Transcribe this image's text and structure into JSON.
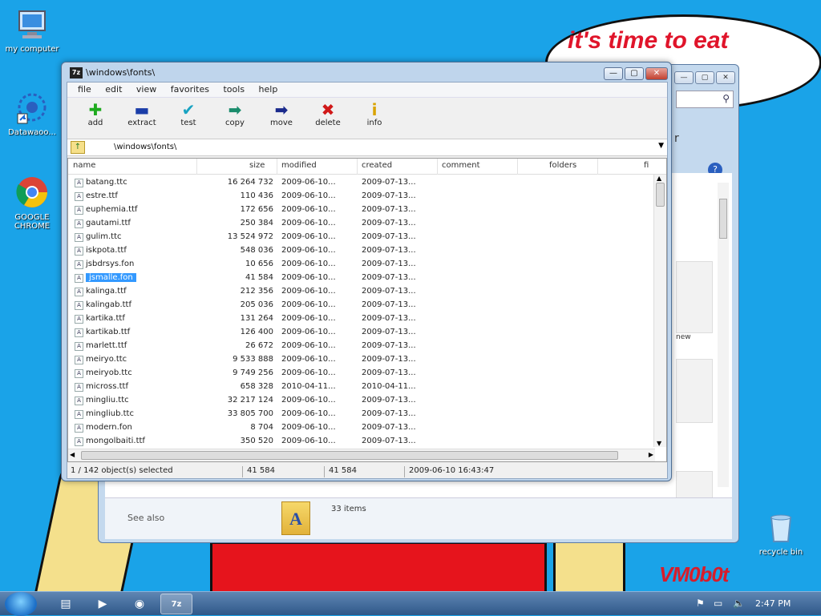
{
  "desktop": {
    "icons": [
      {
        "label": "my computer",
        "icon": "computer-icon"
      },
      {
        "label": "Datawaoo...",
        "icon": "datawaoo-icon"
      },
      {
        "label": "GOOGLE CHROME",
        "icon": "chrome-icon"
      },
      {
        "label": "recycle bin",
        "icon": "recycle-bin-icon"
      }
    ],
    "bubble_text": "it's time to eat",
    "watermark": "VM0b0t"
  },
  "background_window": {
    "see_also": "See also",
    "items_count": "33 items",
    "side_text_new": "new",
    "side_text_r": "r"
  },
  "zip_window": {
    "title": "\\windows\\fonts\\",
    "menu": [
      "file",
      "edit",
      "view",
      "favorites",
      "tools",
      "help"
    ],
    "toolbar": [
      {
        "label": "add",
        "icon": "add-icon",
        "glyph": "✚",
        "color": "#1faa1f"
      },
      {
        "label": "extract",
        "icon": "extract-icon",
        "glyph": "▬",
        "color": "#1a3da8"
      },
      {
        "label": "test",
        "icon": "test-icon",
        "glyph": "✔",
        "color": "#19a3c2"
      },
      {
        "label": "copy",
        "icon": "copy-icon",
        "glyph": "➡",
        "color": "#1a8c6c"
      },
      {
        "label": "move",
        "icon": "move-icon",
        "glyph": "➡",
        "color": "#1a2a8c"
      },
      {
        "label": "delete",
        "icon": "delete-icon",
        "glyph": "✖",
        "color": "#d01818"
      },
      {
        "label": "info",
        "icon": "info-icon",
        "glyph": "i",
        "color": "#d9a300"
      }
    ],
    "path": "\\windows\\fonts\\",
    "columns": [
      "name",
      "size",
      "modified",
      "created",
      "comment",
      "folders",
      "fi"
    ],
    "rows": [
      {
        "name": "batang.ttc",
        "size": "16 264 732",
        "modified": "2009-06-10...",
        "created": "2009-07-13..."
      },
      {
        "name": "estre.ttf",
        "size": "110 436",
        "modified": "2009-06-10...",
        "created": "2009-07-13..."
      },
      {
        "name": "euphemia.ttf",
        "size": "172 656",
        "modified": "2009-06-10...",
        "created": "2009-07-13..."
      },
      {
        "name": "gautami.ttf",
        "size": "250 384",
        "modified": "2009-06-10...",
        "created": "2009-07-13..."
      },
      {
        "name": "gulim.ttc",
        "size": "13 524 972",
        "modified": "2009-06-10...",
        "created": "2009-07-13..."
      },
      {
        "name": "iskpota.ttf",
        "size": "548 036",
        "modified": "2009-06-10...",
        "created": "2009-07-13..."
      },
      {
        "name": "jsbdrsys.fon",
        "size": "10 656",
        "modified": "2009-06-10...",
        "created": "2009-07-13..."
      },
      {
        "name": "jsmalle.fon",
        "size": "41 584",
        "modified": "2009-06-10...",
        "created": "2009-07-13...",
        "selected": true
      },
      {
        "name": "kalinga.ttf",
        "size": "212 356",
        "modified": "2009-06-10...",
        "created": "2009-07-13..."
      },
      {
        "name": "kalingab.ttf",
        "size": "205 036",
        "modified": "2009-06-10...",
        "created": "2009-07-13..."
      },
      {
        "name": "kartika.ttf",
        "size": "131 264",
        "modified": "2009-06-10...",
        "created": "2009-07-13..."
      },
      {
        "name": "kartikab.ttf",
        "size": "126 400",
        "modified": "2009-06-10...",
        "created": "2009-07-13..."
      },
      {
        "name": "marlett.ttf",
        "size": "26 672",
        "modified": "2009-06-10...",
        "created": "2009-07-13..."
      },
      {
        "name": "meiryo.ttc",
        "size": "9 533 888",
        "modified": "2009-06-10...",
        "created": "2009-07-13..."
      },
      {
        "name": "meiryob.ttc",
        "size": "9 749 256",
        "modified": "2009-06-10...",
        "created": "2009-07-13..."
      },
      {
        "name": "micross.ttf",
        "size": "658 328",
        "modified": "2010-04-11...",
        "created": "2010-04-11..."
      },
      {
        "name": "mingliu.ttc",
        "size": "32 217 124",
        "modified": "2009-06-10...",
        "created": "2009-07-13..."
      },
      {
        "name": "mingliub.ttc",
        "size": "33 805 700",
        "modified": "2009-06-10...",
        "created": "2009-07-13..."
      },
      {
        "name": "modern.fon",
        "size": "8 704",
        "modified": "2009-06-10...",
        "created": "2009-07-13..."
      },
      {
        "name": "mongolbaiti.ttf",
        "size": "350 520",
        "modified": "2009-06-10...",
        "created": "2009-07-13..."
      }
    ],
    "status": {
      "selected": "1 / 142 object(s) selected",
      "size1": "41 584",
      "size2": "41 584",
      "date": "2009-06-10 16:43:47"
    }
  },
  "taskbar": {
    "time": "2:47 PM",
    "apps": [
      {
        "name": "explorer-taskbar-icon",
        "glyph": "▤"
      },
      {
        "name": "media-player-taskbar-icon",
        "glyph": "▶"
      },
      {
        "name": "chrome-taskbar-icon",
        "glyph": "◉"
      },
      {
        "name": "7zip-taskbar-icon",
        "glyph": "7z"
      }
    ]
  },
  "colors": {
    "desktop_bg": "#1aa3e8",
    "selection": "#3399ff",
    "bubble_text": "#e0142a"
  }
}
